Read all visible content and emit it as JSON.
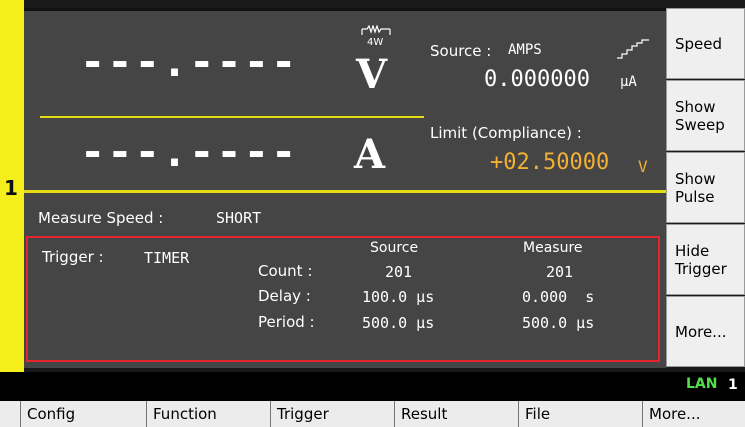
{
  "channel": "1",
  "display": {
    "voltage_reading": "---.----",
    "voltage_unit": "V",
    "current_reading": "---.----",
    "current_unit": "A",
    "sense_label": "4W",
    "source_label": "Source :",
    "source_type": "AMPS",
    "source_value": "0.000000",
    "source_unit": "µA",
    "limit_label": "Limit (Compliance) :",
    "limit_value": "+02.50000",
    "limit_unit": "V",
    "measure_speed_label": "Measure Speed :",
    "measure_speed_value": "SHORT"
  },
  "trigger": {
    "label": "Trigger :",
    "mode": "TIMER",
    "source_header": "Source",
    "measure_header": "Measure",
    "rows": [
      {
        "label": "Count :",
        "source": "201",
        "measure": "201"
      },
      {
        "label": "Delay :",
        "source": "100.0 µs",
        "measure": "0.000  s"
      },
      {
        "label": "Period :",
        "source": "500.0 µs",
        "measure": "500.0 µs"
      }
    ]
  },
  "softkeys": [
    "Speed",
    "Show Sweep",
    "Show Pulse",
    "Hide Trigger",
    "More..."
  ],
  "status": {
    "lan": "LAN",
    "channel": "1"
  },
  "menu": [
    "Config",
    "Function",
    "Trigger",
    "Result",
    "File",
    "More..."
  ],
  "colors": {
    "accent_yellow": "#e5dc12",
    "limit_orange": "#f2b035",
    "highlight_red": "#e3252e",
    "lan_green": "#51e04a"
  }
}
